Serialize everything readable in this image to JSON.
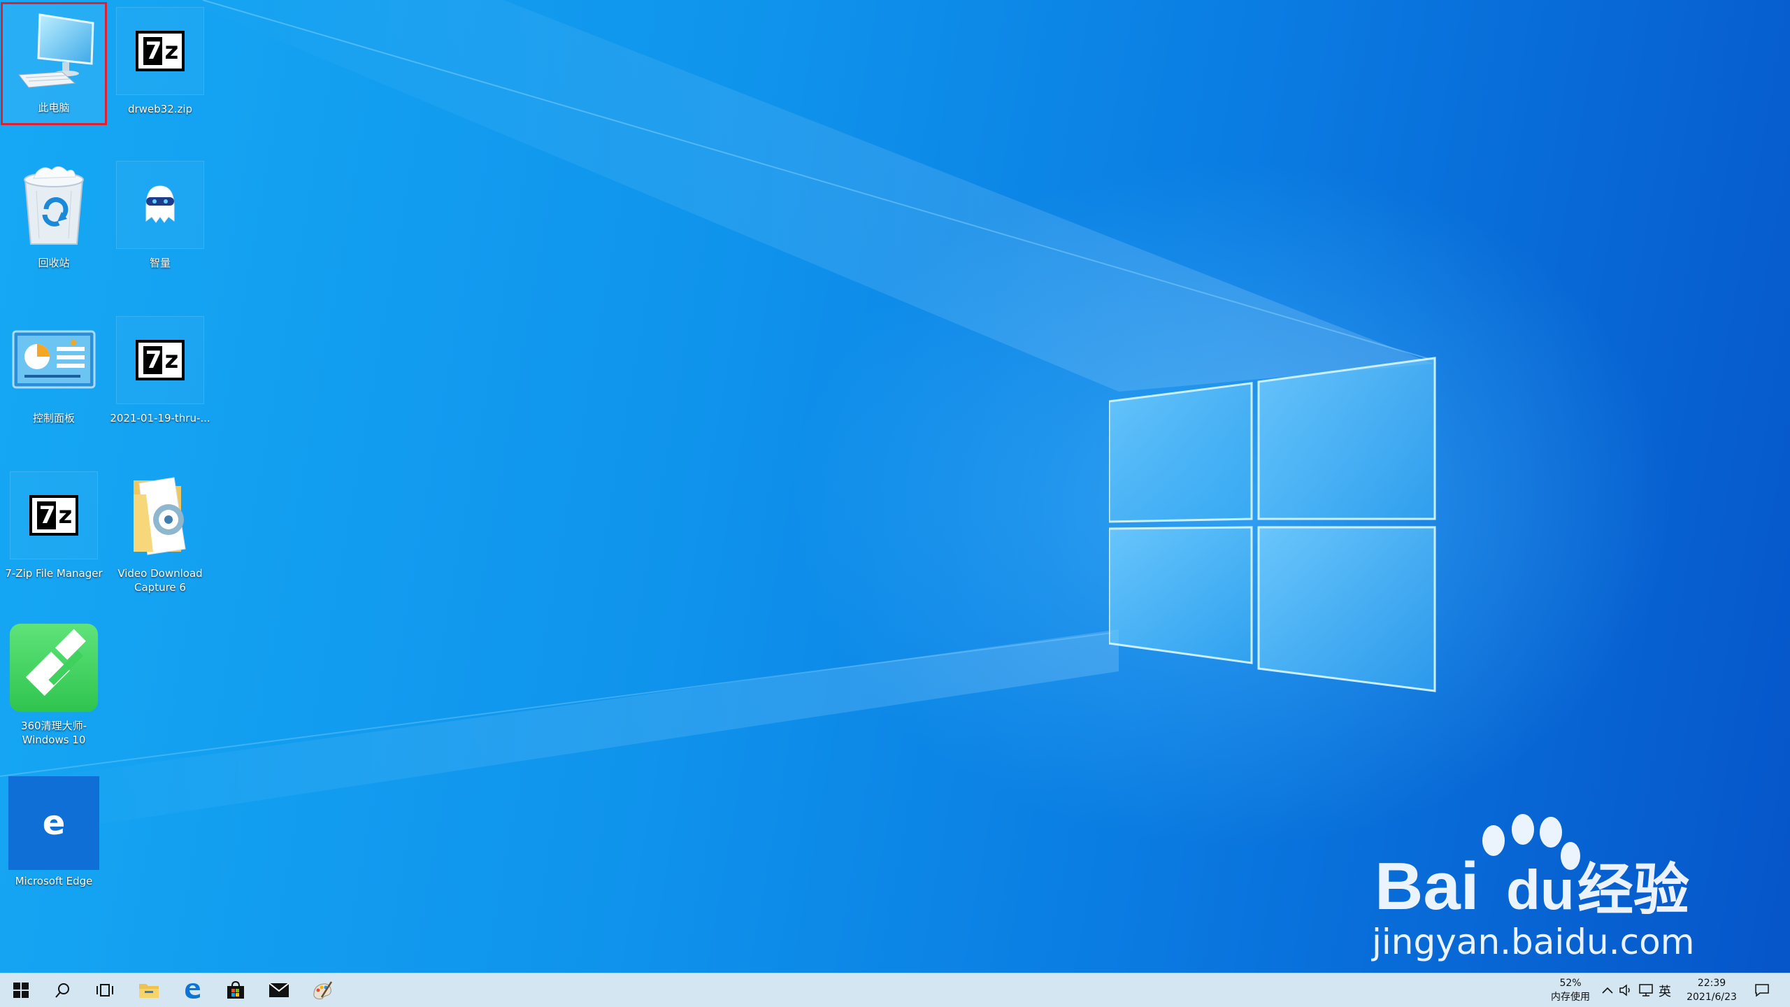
{
  "desktop": {
    "icons": [
      {
        "label": "此电脑",
        "icon": "computer-icon",
        "selected": true
      },
      {
        "label": "drweb32.zip",
        "icon": "7zip-archive-icon"
      },
      {
        "label": "回收站",
        "icon": "recycle-bin-icon"
      },
      {
        "label": "智量",
        "icon": "zhiliang-app-icon"
      },
      {
        "label": "控制面板",
        "icon": "control-panel-icon"
      },
      {
        "label": "2021-01-19-thru-...",
        "icon": "7zip-archive-icon"
      },
      {
        "label": "7-Zip File Manager",
        "icon": "7zip-icon"
      },
      {
        "label": "Video Download Capture 6",
        "icon": "folder-icon"
      },
      {
        "label": "360清理大师-Windows 10",
        "icon": "360-cleaner-icon"
      },
      {
        "label": "Microsoft Edge",
        "icon": "edge-icon"
      }
    ]
  },
  "taskbar": {
    "buttons": [
      {
        "name": "start",
        "icon": "windows-start-icon"
      },
      {
        "name": "search",
        "icon": "search-icon"
      },
      {
        "name": "task-view",
        "icon": "task-view-icon"
      },
      {
        "name": "file-explorer",
        "icon": "folder-icon"
      },
      {
        "name": "edge",
        "icon": "edge-icon"
      },
      {
        "name": "store",
        "icon": "store-icon"
      },
      {
        "name": "mail",
        "icon": "mail-icon"
      },
      {
        "name": "paint",
        "icon": "paint-icon"
      }
    ],
    "memory_percent": "52%",
    "memory_label": "内存使用",
    "ime": "英",
    "time": "22:39",
    "date": "2021/6/23"
  },
  "watermark": {
    "brand": "Bai",
    "brand_du": "du",
    "brand_cn": "经验",
    "url": "jingyan.baidu.com"
  },
  "colors": {
    "selection_outline": "#e0202e",
    "taskbar_bg": "#d3e6f2",
    "wallpaper_blue": "#0a78e0"
  }
}
